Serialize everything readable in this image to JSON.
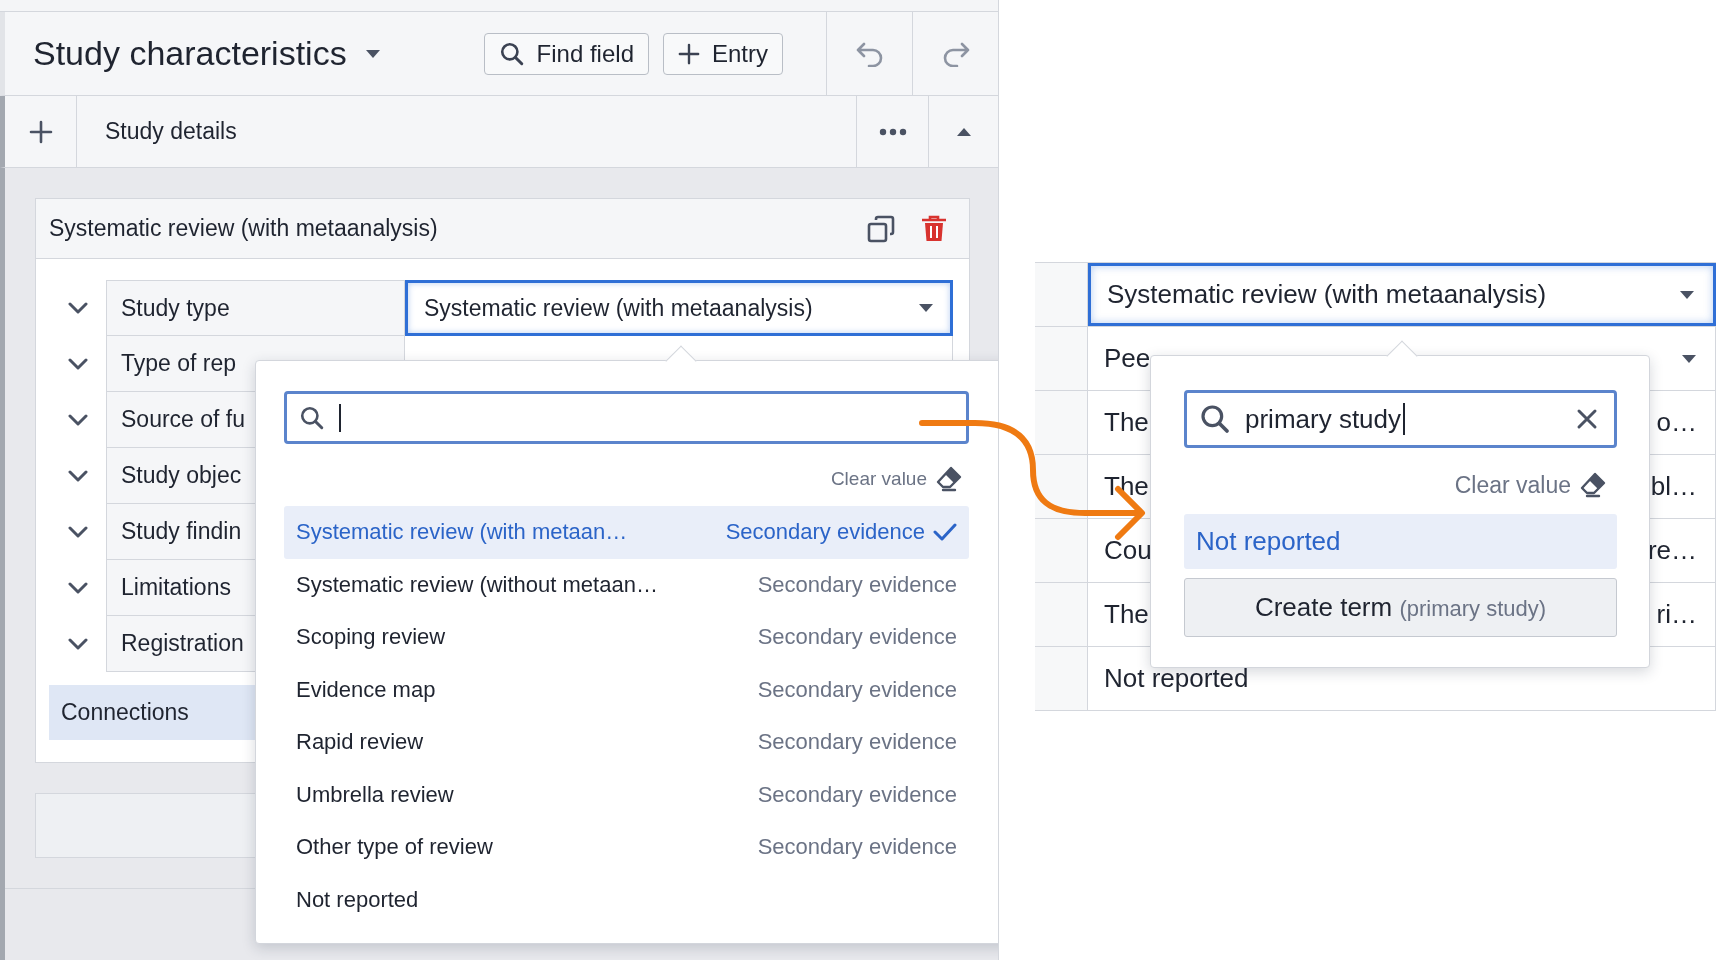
{
  "header": {
    "title": "Study characteristics",
    "buttons": [
      {
        "kind": "search",
        "label": "Find field"
      },
      {
        "kind": "add",
        "label": "Entry"
      }
    ]
  },
  "section": {
    "title": "Study details"
  },
  "card": {
    "title": "Systematic review (with metaanalysis)",
    "fields": [
      {
        "label": "Study type",
        "value": "Systematic review (with metaanalysis)",
        "focused": true
      },
      {
        "label": "Type of rep",
        "focused": false
      },
      {
        "label": "Source of fu"
      },
      {
        "label": "Study objec"
      },
      {
        "label": "Study findin"
      },
      {
        "label": "Limitations"
      },
      {
        "label": "Registration"
      }
    ],
    "connections": "Connections"
  },
  "left_picker": {
    "clear_label": "Clear value",
    "options": [
      {
        "name": "Systematic review (with metaan…",
        "category": "Secondary evidence",
        "selected": true
      },
      {
        "name": "Systematic review (without metaan…",
        "category": "Secondary evidence",
        "selected": false
      },
      {
        "name": "Scoping review",
        "category": "Secondary evidence",
        "selected": false
      },
      {
        "name": "Evidence map",
        "category": "Secondary evidence",
        "selected": false
      },
      {
        "name": "Rapid review",
        "category": "Secondary evidence",
        "selected": false
      },
      {
        "name": "Umbrella review",
        "category": "Secondary evidence",
        "selected": false
      },
      {
        "name": "Other type of review",
        "category": "Secondary evidence",
        "selected": false
      },
      {
        "name": "Not reported",
        "selected": false
      }
    ]
  },
  "right_panel": {
    "rows": [
      {
        "kind": "select",
        "start": "Systematic review (with metaanalysis)",
        "focused": true
      },
      {
        "kind": "select",
        "start": "Pee",
        "focused": false
      },
      {
        "kind": "text",
        "start": "The",
        "end": "o…",
        "focused": false
      },
      {
        "kind": "text",
        "start": "The",
        "end": "bl…",
        "focused": false
      },
      {
        "kind": "text",
        "start": "Cou",
        "end": "re…",
        "focused": false
      },
      {
        "kind": "text",
        "start": "The",
        "end": "ri…",
        "focused": false
      },
      {
        "kind": "text",
        "start": "Not reported",
        "focused": false
      }
    ]
  },
  "right_picker": {
    "query": "primary study",
    "clear_label": "Clear value",
    "options": [
      {
        "name": "Not reported",
        "selected": true
      }
    ],
    "create": {
      "label": "Create term",
      "hint": "(primary study)"
    }
  }
}
